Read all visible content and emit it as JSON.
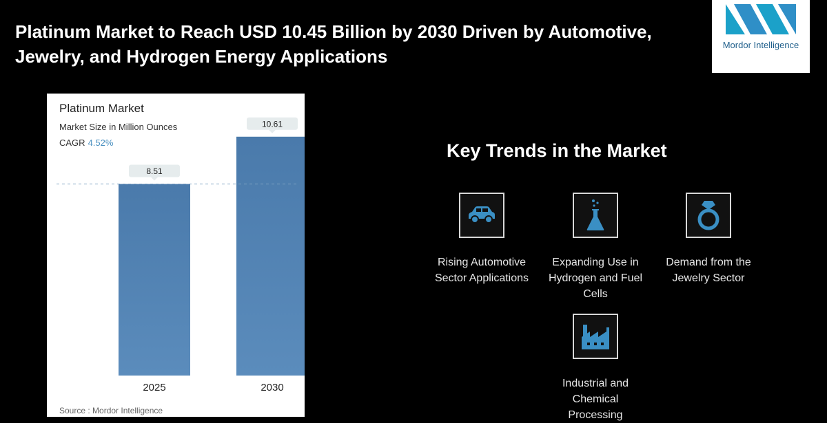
{
  "headline": "Platinum Market to Reach USD 10.45 Billion by 2030 Driven by Automotive, Jewelry, and Hydrogen Energy Applications",
  "logo": {
    "text": "Mordor Intelligence",
    "icon": "mordor-logo-icon"
  },
  "card": {
    "title": "Platinum Market",
    "subtitle": "Market Size in Million Ounces",
    "cagr_label": "CAGR",
    "cagr_value": "4.52%",
    "source": "Source : Mordor Intelligence"
  },
  "chart_data": {
    "type": "bar",
    "categories": [
      "2025",
      "2030"
    ],
    "values": [
      8.51,
      10.61
    ],
    "data_labels": [
      "8.51",
      "10.61"
    ],
    "title": "Platinum Market",
    "ylabel": "Market Size in Million Ounces",
    "ylim": [
      0,
      11
    ],
    "reference_line": 8.51,
    "colors": {
      "bar": "#5b8cbc",
      "bar_dark": "#4a7aab",
      "label_bg": "#e6eced"
    }
  },
  "trends": {
    "title": "Key Trends in the Market",
    "items": [
      {
        "label": "Rising Automotive Sector Applications",
        "icon": "car-icon"
      },
      {
        "label": "Expanding Use in Hydrogen and Fuel Cells",
        "icon": "flask-icon"
      },
      {
        "label": "Demand from the Jewelry Sector",
        "icon": "ring-icon"
      },
      {
        "label": "Industrial and Chemical Processing",
        "icon": "factory-icon"
      }
    ]
  },
  "colors": {
    "accent": "#1ba1c9",
    "icon_blue": "#3a8fc4"
  }
}
